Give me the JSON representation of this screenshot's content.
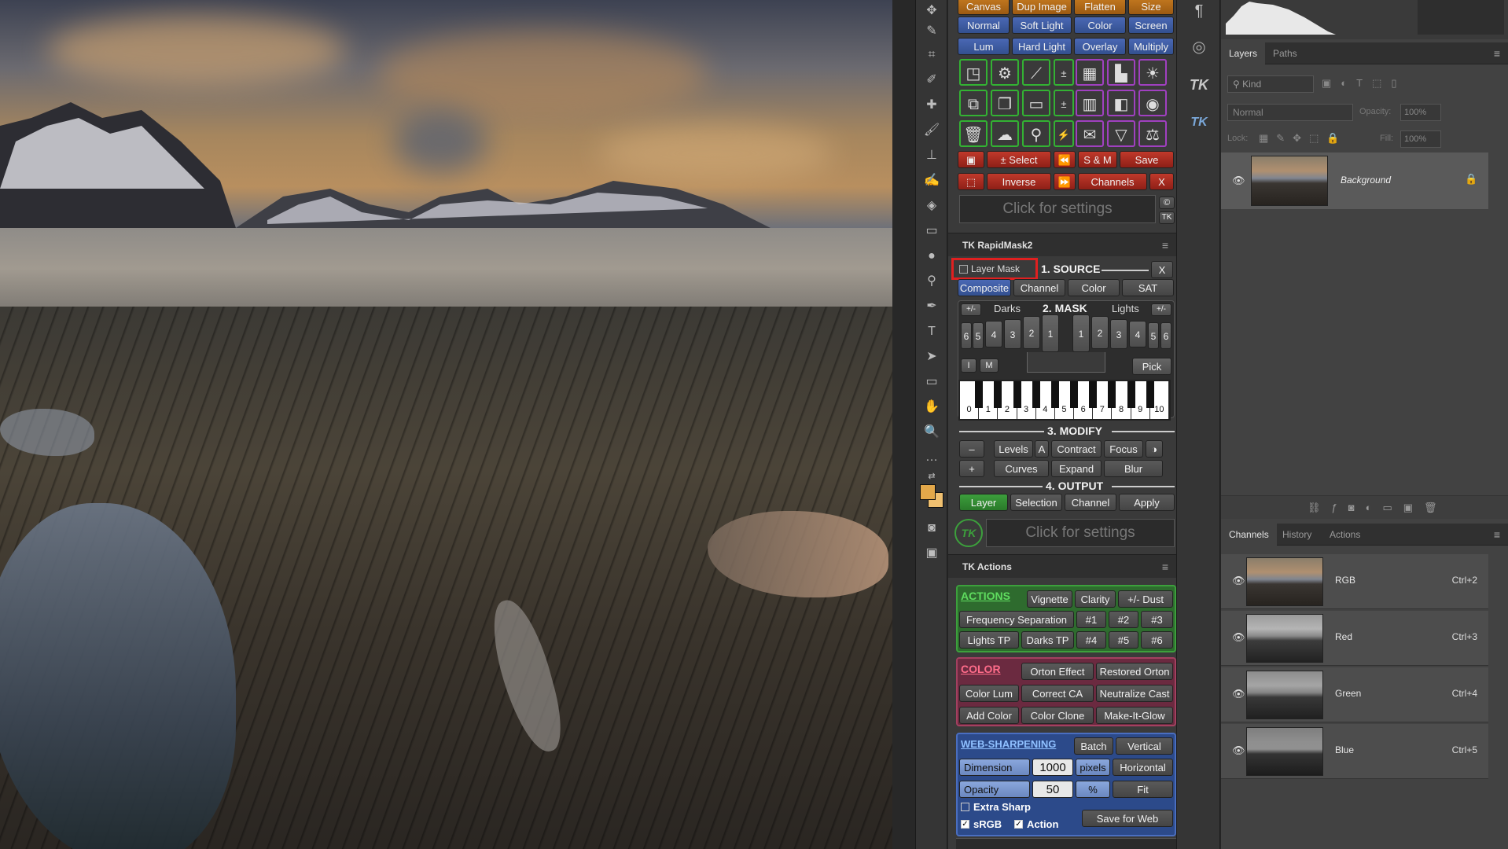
{
  "toolbar_top": {
    "row1": [
      "Canvas",
      "Dup Image",
      "Flatten",
      "Size"
    ],
    "row2": [
      "Normal",
      "Soft Light",
      "Color",
      "Screen"
    ],
    "row3": [
      "Lum",
      "Hard Light",
      "Overlay",
      "Multiply"
    ]
  },
  "tk_main": {
    "select_label": "± Select",
    "sm_label": "S & M",
    "save_label": "Save",
    "inverse_label": "Inverse",
    "channels_label": "Channels",
    "x_label": "X",
    "settings_placeholder": "Click for settings",
    "copyright_symbol": "©",
    "tk_mini": "TK"
  },
  "rapidmask": {
    "title": "TK RapidMask2",
    "layer_mask_label": "Layer Mask",
    "source_title": "1. SOURCE",
    "close_label": "X",
    "source_buttons": [
      "Composite",
      "Channel",
      "Color",
      "SAT"
    ],
    "mask_title": "2. MASK",
    "darks_label": "Darks",
    "lights_label": "Lights",
    "plusminus": "+/-",
    "dark_numbers": [
      "6",
      "5",
      "4",
      "3",
      "2",
      "1"
    ],
    "light_numbers": [
      "1",
      "2",
      "3",
      "4",
      "5",
      "6"
    ],
    "i_label": "I",
    "m_label": "M",
    "pick_label": "Pick",
    "key_labels": [
      "0",
      "1",
      "2",
      "3",
      "4",
      "5",
      "6",
      "7",
      "8",
      "9",
      "10"
    ],
    "modify_title": "3. MODIFY",
    "minus_label": "–",
    "plus_label": "+",
    "levels_label": "Levels",
    "a_label": "A",
    "contract_label": "Contract",
    "focus_label": "Focus",
    "curves_label": "Curves",
    "expand_label": "Expand",
    "blur_label": "Blur",
    "output_title": "4. OUTPUT",
    "output_buttons": [
      "Layer",
      "Selection",
      "Channel",
      "Apply"
    ],
    "settings_placeholder": "Click for settings",
    "logo_text": "TK"
  },
  "tk_actions": {
    "title": "TK Actions",
    "actions_label": "ACTIONS",
    "vignette": "Vignette",
    "clarity": "Clarity",
    "dust": "+/- Dust",
    "freq_sep": "Frequency Separation",
    "n1": "#1",
    "n2": "#2",
    "n3": "#3",
    "lights_tp": "Lights TP",
    "darks_tp": "Darks TP",
    "n4": "#4",
    "n5": "#5",
    "n6": "#6",
    "color_label": "COLOR",
    "orton": "Orton Effect",
    "restored_orton": "Restored Orton",
    "color_lum": "Color Lum",
    "correct_ca": "Correct CA",
    "neutralize_cast": "Neutralize Cast",
    "add_color": "Add Color",
    "color_clone": "Color Clone",
    "make_it_glow": "Make-It-Glow",
    "web_label": "WEB-SHARPENING",
    "batch": "Batch",
    "vertical": "Vertical",
    "dimension_label": "Dimension",
    "dimension_value": "1000",
    "pixels_label": "pixels",
    "horizontal": "Horizontal",
    "opacity_label": "Opacity",
    "opacity_value": "50",
    "percent_label": "%",
    "fit": "Fit",
    "extra_sharp": "Extra Sharp",
    "srgb": "sRGB",
    "action": "Action",
    "save_for_web": "Save for Web"
  },
  "layers_panel": {
    "tabs": [
      "Layers",
      "Paths"
    ],
    "kind_label": "Kind",
    "blend_mode": "Normal",
    "opacity_label": "Opacity:",
    "opacity_value": "100%",
    "lock_label": "Lock:",
    "fill_label": "Fill:",
    "fill_value": "100%",
    "layer_name": "Background"
  },
  "channels_panel": {
    "tabs": [
      "Channels",
      "History",
      "Actions"
    ],
    "channels": [
      {
        "name": "RGB",
        "shortcut": "Ctrl+2"
      },
      {
        "name": "Red",
        "shortcut": "Ctrl+3"
      },
      {
        "name": "Green",
        "shortcut": "Ctrl+4"
      },
      {
        "name": "Blue",
        "shortcut": "Ctrl+5"
      }
    ]
  },
  "colors": {
    "foreground": "#e3a84a",
    "background": "#f0c070",
    "highlight_red": "#e02020"
  }
}
